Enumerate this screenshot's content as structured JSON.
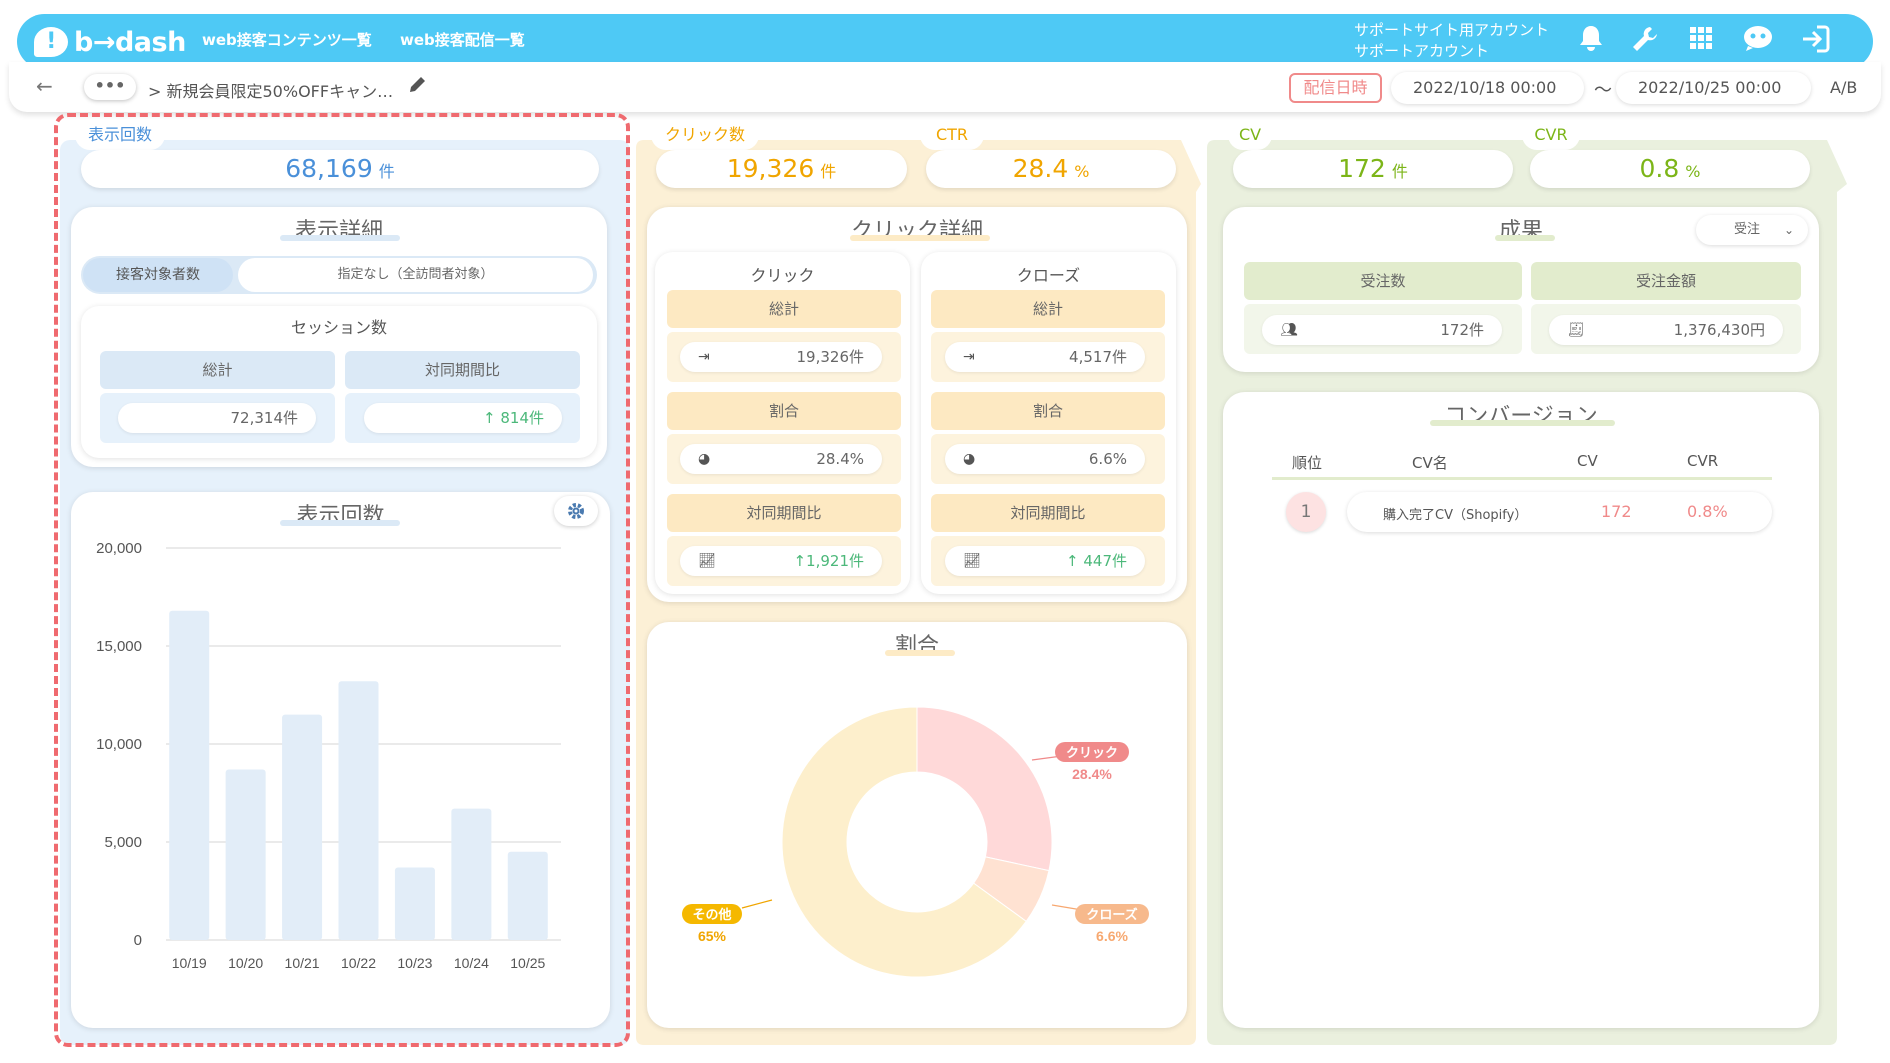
{
  "header": {
    "logo": "b→dash",
    "nav": [
      "web接客コンテンツ一覧",
      "web接客配信一覧"
    ],
    "account_line1": "サポートサイト用アカウント",
    "account_line2": "サポートアカウント",
    "icons": [
      "bell-icon",
      "wrench-icon",
      "grid-icon",
      "chat-robot-icon",
      "logout-icon"
    ]
  },
  "breadcrumb": {
    "back_icon": "arrow-left-icon",
    "more_label": "•••",
    "separator": ">",
    "title": "新規会員限定50%OFFキャン…",
    "edit_icon": "pencil-icon"
  },
  "schedule": {
    "label": "配信日時",
    "start": "2022/10/18 00:00",
    "tilde": "〜",
    "end": "2022/10/25 00:00",
    "ab": "A/B"
  },
  "impressions": {
    "tag": "表示回数",
    "value": "68,169",
    "unit": "件",
    "detail_title": "表示詳細",
    "segment_label": "接客対象者数",
    "segment_value": "指定なし（全訪問者対象）",
    "sessions_title": "セッション数",
    "total_header": "総計",
    "yoy_header": "対同期間比",
    "total_value": "72,314件",
    "yoy_value": "↑ 814件",
    "chart_title": "表示回数",
    "gear_icon": "gear-icon"
  },
  "clicks": {
    "tag": "クリック数",
    "value": "19,326",
    "unit": "件",
    "detail_title": "クリック詳細",
    "click_col": {
      "title": "クリック",
      "total_header": "総計",
      "total_value": "19,326件",
      "ratio_header": "割合",
      "ratio_value": "28.4%",
      "yoy_header": "対同期間比",
      "yoy_value": "↑1,921件"
    },
    "close_col": {
      "title": "クローズ",
      "total_header": "総計",
      "total_value": "4,517件",
      "ratio_header": "割合",
      "ratio_value": "6.6%",
      "yoy_header": "対同期間比",
      "yoy_value": "↑ 447件"
    },
    "ratio_title": "割合"
  },
  "ctr": {
    "tag": "CTR",
    "value": "28.4",
    "unit": "%"
  },
  "cv": {
    "tag": "CV",
    "value": "172",
    "unit": "件"
  },
  "cvr": {
    "tag": "CVR",
    "value": "0.8",
    "unit": "%"
  },
  "results": {
    "title": "成果",
    "dropdown": "受注",
    "orders_header": "受注数",
    "amount_header": "受注金額",
    "orders_value": "172件",
    "amount_value": "1,376,430円"
  },
  "conversions": {
    "title": "コンバージョン",
    "columns": [
      "順位",
      "CV名",
      "CV",
      "CVR"
    ],
    "rows": [
      {
        "rank": "1",
        "name": "購入完了CV（Shopify）",
        "cv": "172",
        "cvr": "0.8%"
      }
    ]
  },
  "colors": {
    "header_blue": "#4ec9f5",
    "impressions_blue": "#4a90d9",
    "clicks_orange": "#f0a500",
    "cv_green": "#7cb518",
    "highlight_red": "#ef6a6f"
  },
  "chart_data": [
    {
      "type": "bar",
      "title": "表示回数",
      "categories": [
        "10/19",
        "10/20",
        "10/21",
        "10/22",
        "10/23",
        "10/24",
        "10/25"
      ],
      "values": [
        16800,
        8700,
        11500,
        13200,
        3700,
        6700,
        4500
      ],
      "yticks": [
        "20,000",
        "15,000",
        "10,000",
        "5,000",
        "0"
      ],
      "ylim": [
        0,
        20000
      ],
      "grid": true
    },
    {
      "type": "pie",
      "title": "割合",
      "donut": true,
      "slices": [
        {
          "label": "クリック",
          "pct_label": "28.4%",
          "value": 28.4,
          "color": "#ffd9d9"
        },
        {
          "label": "クローズ",
          "pct_label": "6.6%",
          "value": 6.6,
          "color": "#ffe2d2"
        },
        {
          "label": "その他",
          "pct_label": "65%",
          "value": 65,
          "color": "#fdefcc"
        }
      ]
    }
  ]
}
